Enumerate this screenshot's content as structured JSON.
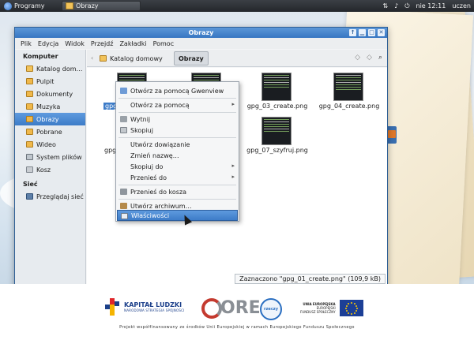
{
  "taskbar": {
    "menu_label": "Programy",
    "task_label": "Obrazy",
    "clock": "nie 12:11",
    "user": "uczen"
  },
  "window": {
    "title": "Obrazy",
    "menu": [
      "Plik",
      "Edycja",
      "Widok",
      "Przejdź",
      "Zakładki",
      "Pomoc"
    ],
    "sidebar": {
      "computer_heading": "Komputer",
      "items": [
        {
          "label": "Katalog dom…",
          "icon": "home-folder-icon"
        },
        {
          "label": "Pulpit",
          "icon": "desktop-folder-icon"
        },
        {
          "label": "Dokumenty",
          "icon": "documents-folder-icon"
        },
        {
          "label": "Muzyka",
          "icon": "music-folder-icon"
        },
        {
          "label": "Obrazy",
          "icon": "pictures-folder-icon",
          "selected": true
        },
        {
          "label": "Pobrane",
          "icon": "downloads-folder-icon"
        },
        {
          "label": "Wideo",
          "icon": "videos-folder-icon"
        },
        {
          "label": "System plików",
          "icon": "drive-icon"
        },
        {
          "label": "Kosz",
          "icon": "trash-icon"
        }
      ],
      "network_heading": "Sieć",
      "network_item": {
        "label": "Przeglądaj sieć",
        "icon": "network-icon"
      }
    },
    "breadcrumb": {
      "home": "Katalog domowy",
      "current": "Obrazy"
    },
    "files": [
      {
        "name": "gpg_01",
        "selected": true
      },
      {
        "name": ""
      },
      {
        "name": "gpg_03_create.png"
      },
      {
        "name": "gpg_04_create.png"
      },
      {
        "name": "gpg_05"
      },
      {
        "name": ""
      },
      {
        "name": "gpg_07_szyfruj.png"
      }
    ],
    "status": "Zaznaczono \"gpg_01_create.png\" (109,9 kB)"
  },
  "context_menu": {
    "items": [
      {
        "label": "Otwórz za pomocą Gwenview",
        "icon": "gwenview-icon"
      },
      {
        "label": "Otwórz za pomocą",
        "submenu": true
      },
      {
        "label": "Wytnij",
        "icon": "cut-icon"
      },
      {
        "label": "Skopiuj",
        "icon": "copy-icon"
      },
      {
        "label": "Utwórz dowiązanie"
      },
      {
        "label": "Zmień nazwę…"
      },
      {
        "label": "Skopiuj do",
        "submenu": true
      },
      {
        "label": "Przenieś do",
        "submenu": true
      },
      {
        "label": "Przenieś do kosza",
        "icon": "trash-icon"
      },
      {
        "label": "Utwórz archiwum…",
        "icon": "archive-icon"
      },
      {
        "label": "Właściwości",
        "icon": "properties-icon",
        "highlighted": true
      }
    ],
    "submenu_glyph": "▸"
  },
  "footer": {
    "kapital_title": "KAPITAŁ LUDZKI",
    "kapital_sub": "NARODOWA STRATEGIA SPÓJNOŚCI",
    "ore": "ORE",
    "rzs": "rzeczy",
    "ue_line1": "UNIA EUROPEJSKA",
    "ue_line2": "EUROPEJSKI",
    "ue_line3": "FUNDUSZ SPOŁECZNY",
    "caption": "Projekt współfinansowany ze środków Unii Europejskiej w ramach Europejskiego Funduszu Społecznego"
  }
}
